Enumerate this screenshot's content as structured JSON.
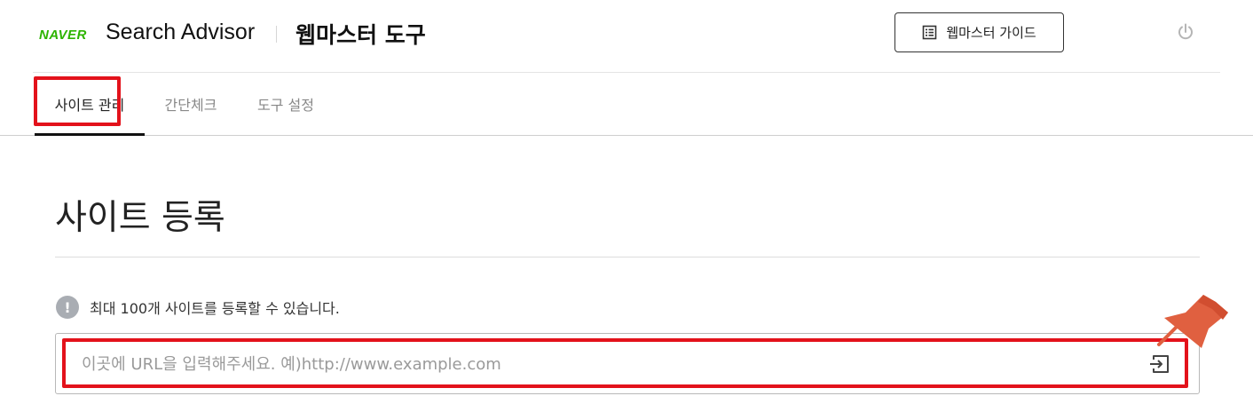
{
  "header": {
    "logo": "NAVER",
    "product_name": "Search Advisor",
    "tool_title": "웹마스터 도구",
    "guide_button_label": "웹마스터 가이드",
    "guide_icon": "list-document-icon",
    "power_icon": "power-icon"
  },
  "tabs": [
    {
      "label": "사이트 관리",
      "active": true
    },
    {
      "label": "간단체크",
      "active": false
    },
    {
      "label": "도구 설정",
      "active": false
    }
  ],
  "main": {
    "title": "사이트 등록",
    "info_icon": "!",
    "info_text": "최대 100개 사이트를 등록할 수 있습니다.",
    "url_input": {
      "value": "",
      "placeholder": "이곳에 URL을 입력해주세요. 예)http://www.example.com"
    },
    "submit_icon": "enter-icon"
  },
  "annotations": {
    "highlight_color": "#e3121b",
    "pin_color": "#e06040",
    "pin_icon": "pushpin-icon"
  },
  "colors": {
    "naver_green": "#2db400",
    "text_primary": "#222222",
    "text_muted": "#888888"
  }
}
